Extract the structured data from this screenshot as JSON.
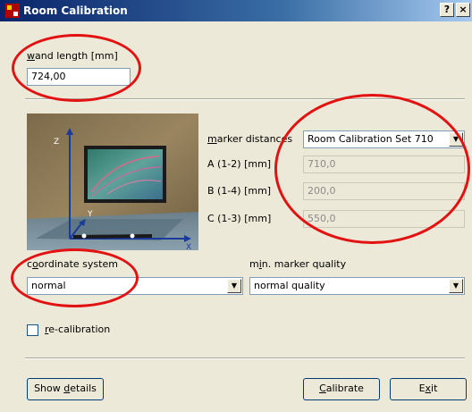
{
  "window": {
    "title": "Room Calibration",
    "help_button": "?",
    "close_button": "×"
  },
  "wand_length": {
    "label_accesskey": "w",
    "label_rest": "and length [mm]",
    "value": "724,00"
  },
  "marker_distances": {
    "label_accesskey": "m",
    "label_rest": "arker distances",
    "selected": "Room Calibration Set 710",
    "rows": [
      {
        "label": "A (1-2) [mm]",
        "value": "710,0"
      },
      {
        "label": "B (1-4) [mm]",
        "value": "200,0"
      },
      {
        "label": "C (1-3) [mm]",
        "value": "550,0"
      }
    ]
  },
  "figure": {
    "z_axis": "Z",
    "y_axis": "Y",
    "x_axis": "X"
  },
  "coordinate_system": {
    "label_pre": "c",
    "label_accesskey": "o",
    "label_rest": "ordinate system",
    "selected": "normal"
  },
  "marker_quality": {
    "label_pre": "m",
    "label_accesskey": "i",
    "label_rest": "n. marker quality",
    "selected": "normal quality"
  },
  "recalibration": {
    "label_accesskey": "r",
    "label_rest": "e-calibration",
    "checked": false
  },
  "buttons": {
    "details_pre": "Show ",
    "details_accesskey": "d",
    "details_rest": "etails",
    "calibrate_accesskey": "C",
    "calibrate_rest": "alibrate",
    "exit_pre": "E",
    "exit_accesskey": "x",
    "exit_rest": "it"
  },
  "colors": {
    "annotation": "#e31212",
    "titlebar": "#0a246a",
    "dialog": "#ece9d8"
  }
}
